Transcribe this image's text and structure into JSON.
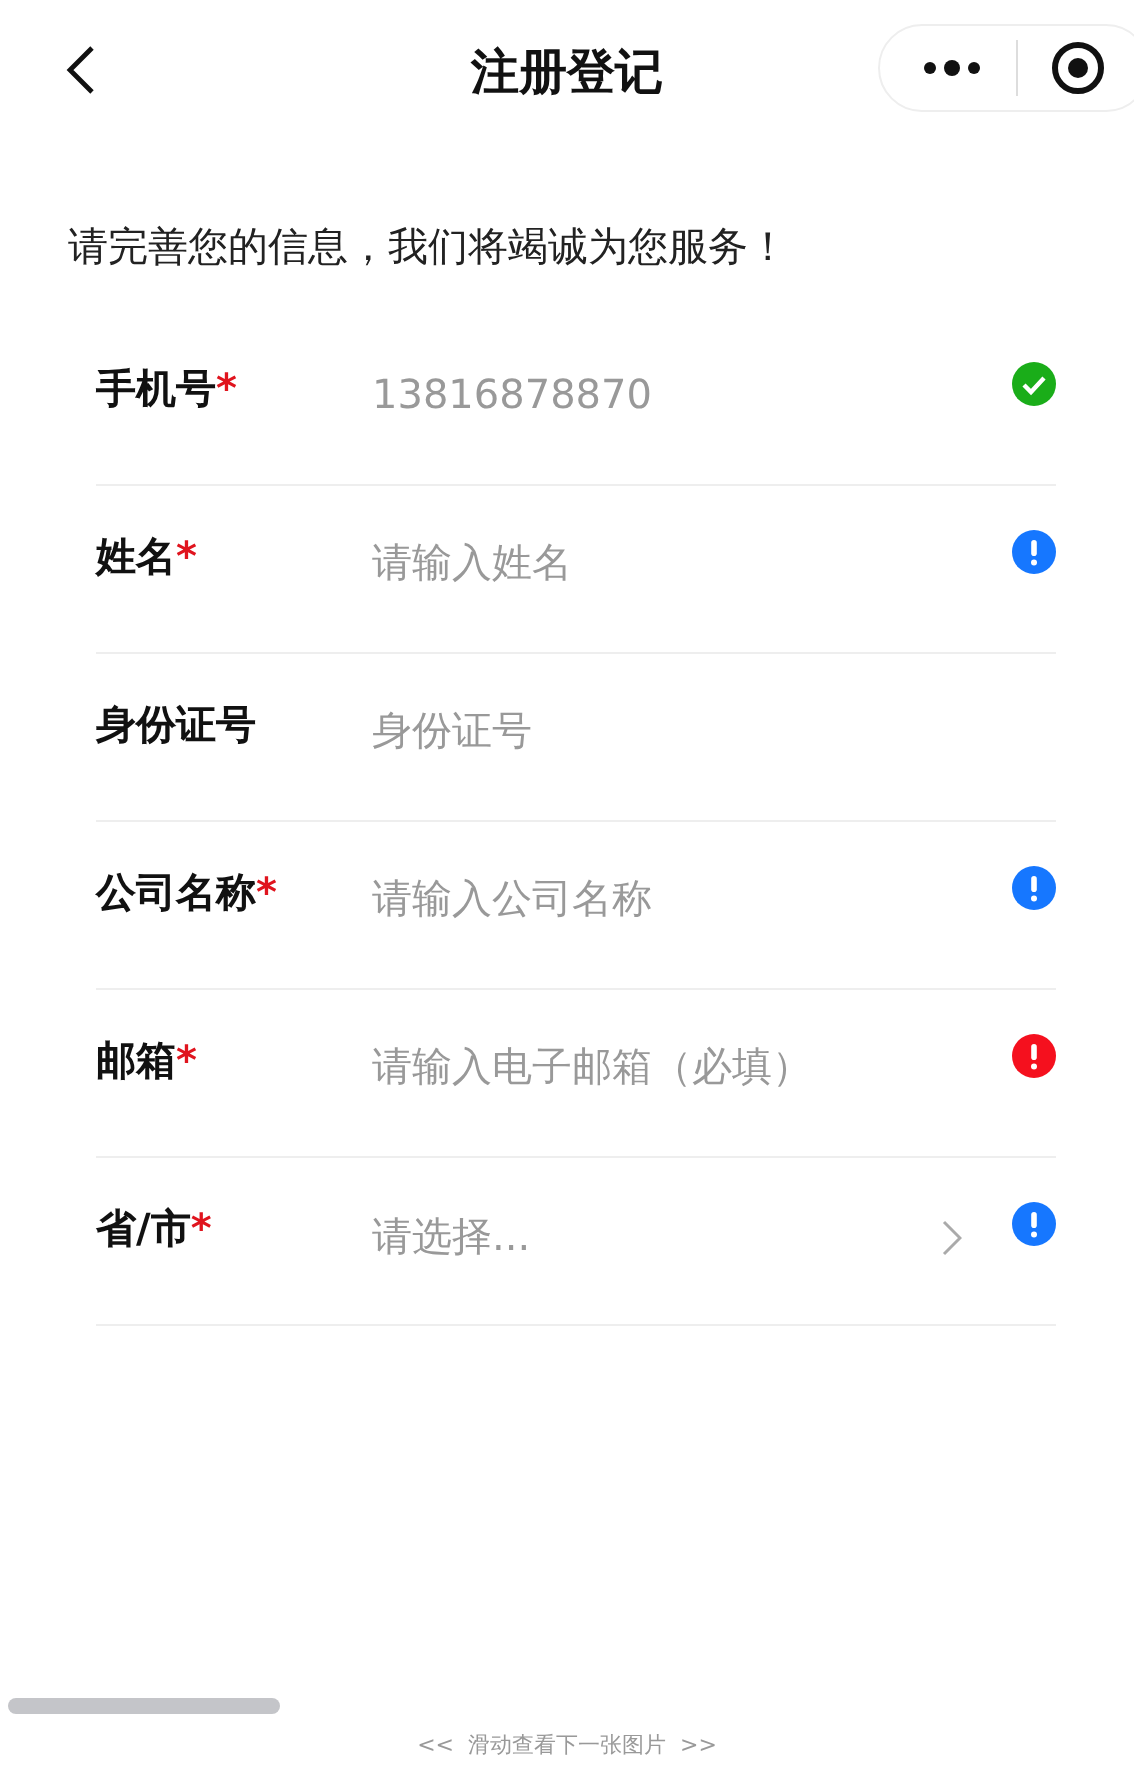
{
  "nav": {
    "title": "注册登记"
  },
  "intro": "请完善您的信息，我们将竭诚为您服务！",
  "fields": [
    {
      "kind": "input",
      "label": "手机号",
      "required_mark": "*",
      "value": "13816878870",
      "status_icon": {
        "kind": "check",
        "color": "#1aad19"
      }
    },
    {
      "kind": "input",
      "label": "姓名",
      "required_mark": "*",
      "placeholder": "请输入姓名",
      "status_icon": {
        "kind": "alert",
        "color": "#1677ff"
      }
    },
    {
      "kind": "input",
      "label": "身份证号",
      "placeholder": "身份证号"
    },
    {
      "kind": "input",
      "label": "公司名称",
      "required_mark": "*",
      "placeholder": "请输入公司名称",
      "status_icon": {
        "kind": "alert",
        "color": "#1677ff"
      }
    },
    {
      "kind": "input",
      "label": "邮箱",
      "required_mark": "*",
      "placeholder": "请输入电子邮箱（必填）",
      "status_icon": {
        "kind": "alert",
        "color": "#f5101e"
      }
    },
    {
      "kind": "select",
      "label": "省/市",
      "required_mark": "*",
      "placeholder": "请选择...",
      "status_icon": {
        "kind": "alert",
        "color": "#1677ff"
      }
    }
  ],
  "footer": {
    "hint": "<<  滑动查看下一张图片  >>"
  }
}
